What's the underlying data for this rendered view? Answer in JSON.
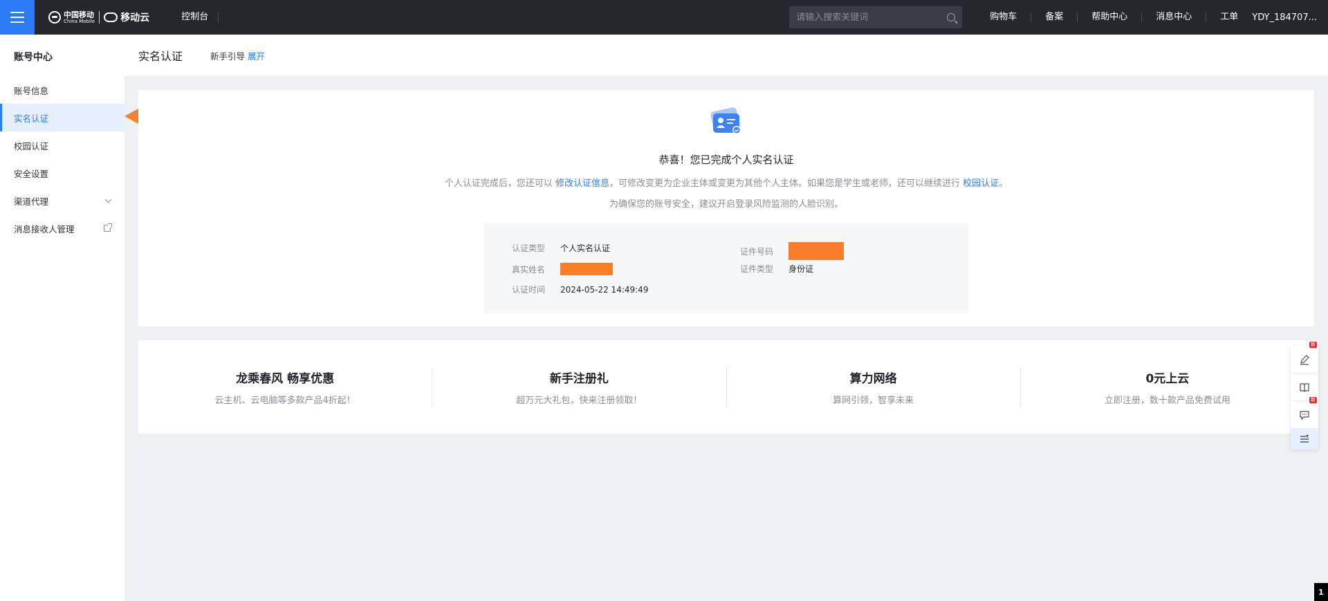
{
  "header": {
    "logo_cm_text": "中国移动",
    "logo_cm_sub": "China Mobile",
    "logo_yd_text": "移动云",
    "console": "控制台",
    "search_placeholder": "请输入搜索关键词",
    "nav": [
      "购物车",
      "备案",
      "帮助中心",
      "消息中心",
      "工单"
    ],
    "user": "YDY_184707..."
  },
  "sidebar": {
    "title": "账号中心",
    "items": [
      {
        "label": "账号信息"
      },
      {
        "label": "实名认证",
        "active": true
      },
      {
        "label": "校园认证"
      },
      {
        "label": "安全设置"
      },
      {
        "label": "渠道代理",
        "icon": "chevron-down-icon"
      },
      {
        "label": "消息接收人管理",
        "icon": "external-link-icon"
      }
    ]
  },
  "page": {
    "title": "实名认证",
    "guide_label": "新手引导",
    "guide_link": "展开"
  },
  "cert": {
    "title": "恭喜！您已完成个人实名认证",
    "desc_part1": "个人认证完成后，您还可以",
    "desc_link1": "修改认证信息",
    "desc_part2": "，可修改变更为企业主体或变更为其他个人主体。如果您是学生或老师，还可以继续进行",
    "desc_link2": "校园认证",
    "desc_part3": "。",
    "tip": "为确保您的账号安全，建议开启登录风险监测的人脸识别。",
    "info": {
      "type_label": "认证类型",
      "type_value": "个人实名认证",
      "name_label": "真实姓名",
      "time_label": "认证时间",
      "time_value": "2024-05-22 14:49:49",
      "id_label": "证件号码",
      "id_type_label": "证件类型",
      "id_type_value": "身份证"
    }
  },
  "promos": [
    {
      "title": "龙乘春风 畅享优惠",
      "sub": "云主机、云电脑等多款产品4折起！"
    },
    {
      "title": "新手注册礼",
      "sub": "超万元大礼包，快来注册领取！"
    },
    {
      "title": "算力网络",
      "sub": "算网引领，智享未来"
    },
    {
      "title": "0元上云",
      "sub": "立即注册，数十款产品免费试用"
    }
  ],
  "float_bar": {
    "badge": "新",
    "icons": [
      "edit-icon",
      "book-icon",
      "chat-icon",
      "list-icon"
    ]
  },
  "page_number": "1",
  "colors": {
    "accent": "#2b7cf6",
    "topbar": "#25272c",
    "redaction": "#fa7d2a",
    "arrow": "#f5822a"
  }
}
